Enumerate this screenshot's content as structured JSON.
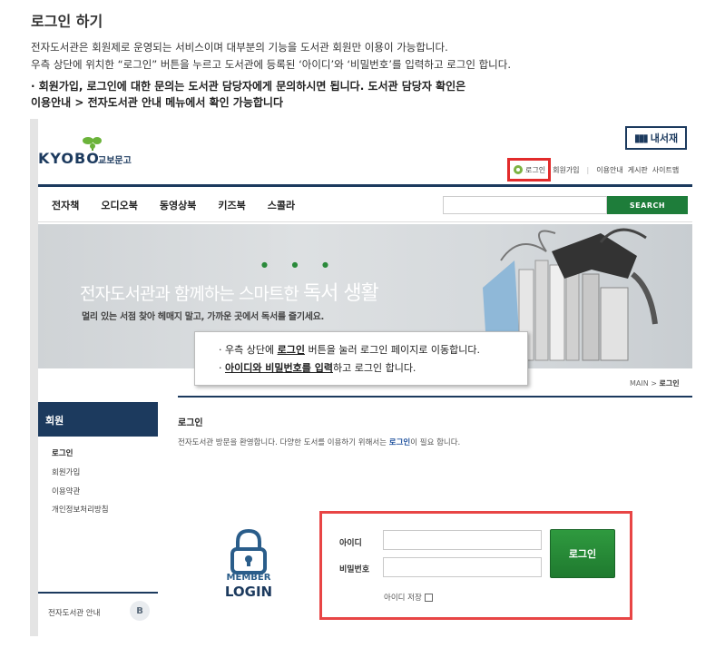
{
  "guide": {
    "title": "로그인 하기",
    "line1": "전자도서관은 회원제로 운영되는 서비스이며 대부분의 기능을 도서관 회원만 이용이 가능합니다.",
    "line2": "우측 상단에 위치한 “로그인” 버튼을 누르고 도서관에 등록된 ‘아이디’와 ‘비밀번호’를 입력하고 로그인 합니다.",
    "note1": "· 회원가입, 로그인에 대한 문의는 도서관 담당자에게 문의하시면 됩니다. 도서관 담당자 확인은",
    "note2": "이용안내 > 전자도서관 안내 메뉴에서 확인 가능합니다"
  },
  "site": {
    "logo_text": "KYOBO",
    "logo_ko": "교보문고",
    "mylib_label": "내서재",
    "top_links": {
      "login": "로그인",
      "signup": "회원가입",
      "guide": "이용안내",
      "board": "게시판",
      "sitemap": "사이트맵"
    },
    "gnb": [
      "전자책",
      "오디오북",
      "동영상북",
      "키즈북",
      "스콜라"
    ],
    "search_button": "SEARCH",
    "search_value": "",
    "banner": {
      "title_a": "전자도서관과 함께하는 스마트한 ",
      "title_b": "독서 생활",
      "subtitle": "멀리 있는 서점 찾아 헤매지 말고, 가까운 곳에서 독서를 즐기세요."
    },
    "breadcrumb": {
      "home": "MAIN",
      "sep": " > ",
      "current": "로그인"
    },
    "lnb": {
      "head": "회원",
      "items": [
        "로그인",
        "회원가입",
        "이용약관",
        "개인정보처리방침"
      ],
      "footer": "전자도서관 안내"
    },
    "page": {
      "title": "로그인",
      "desc_a": "전자도서관 방문을 환영합니다. 다양한 도서를 이용하기 위해서는 ",
      "desc_b": "로그인",
      "desc_c": "이 필요 합니다."
    },
    "member_logo": {
      "line1": "MEMBER",
      "line2": "LOGIN"
    },
    "form": {
      "id_label": "아이디",
      "pw_label": "비밀번호",
      "id_value": "",
      "pw_value": "",
      "submit": "로그인",
      "save_id": "아이디 저장"
    }
  },
  "callout": {
    "l1_a": "· 우측 상단에 ",
    "l1_b": "로그인",
    "l1_c": " 버튼을 눌러 로그인 페이지로 이동합니다.",
    "l2_a": "· ",
    "l2_b": "아이디와 비밀번호를 입력",
    "l2_c": "하고 로그인 합니다."
  },
  "colors": {
    "navy": "#1c3a5e",
    "green": "#1e7d3a",
    "highlight_red": "#e22b2b"
  }
}
